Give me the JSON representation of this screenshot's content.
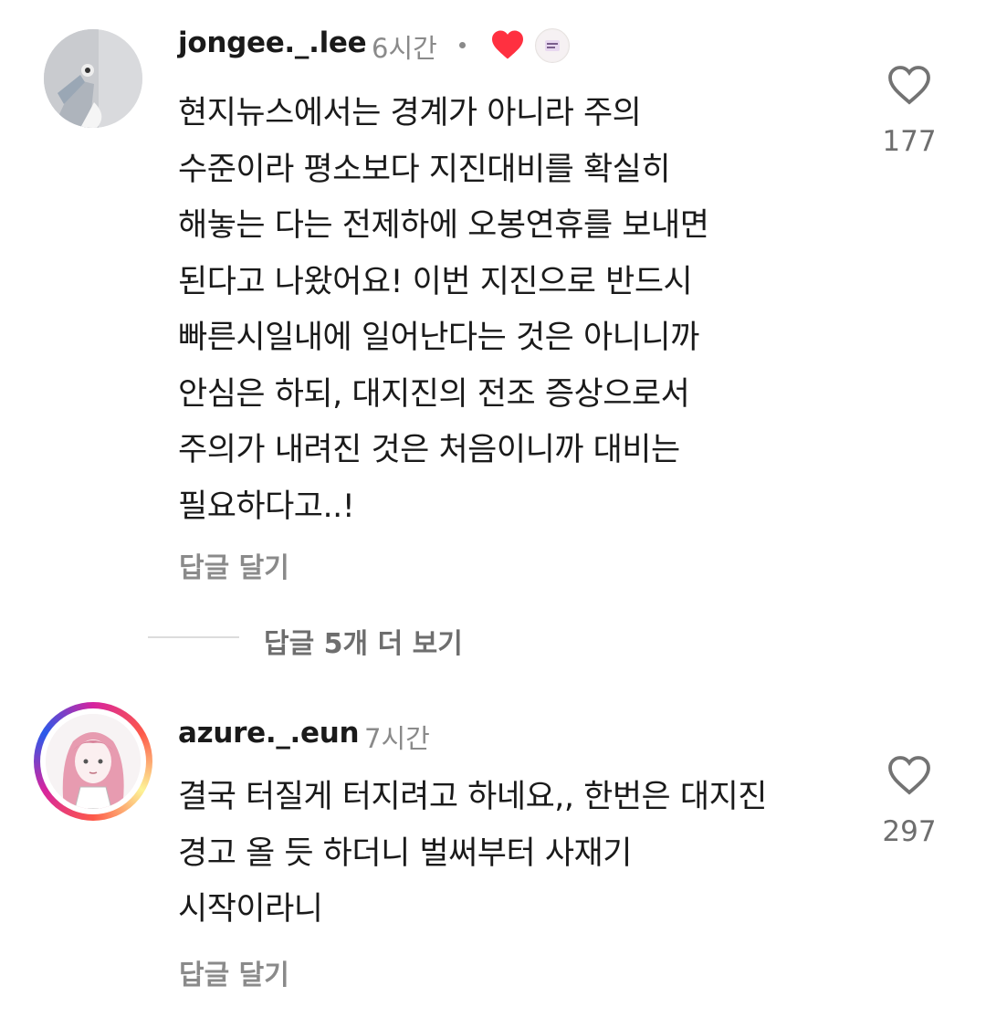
{
  "comments": [
    {
      "username": "jongee._.lee",
      "time": "6시간",
      "text": "현지뉴스에서는 경계가 아니라 주의\n수준이라 평소보다 지진대비를 확실히\n해놓는 다는 전제하에 오봉연휴를 보내면\n된다고 나왔어요! 이번 지진으로 반드시\n빠른시일내에 일어난다는 것은 아니니까\n안심은 하되, 대지진의 전조 증상으로서\n주의가 내려진 것은 처음이니까 대비는\n필요하다고..!",
      "reply_label": "답글 달기",
      "like_count": "177",
      "creator_liked": true,
      "more_replies": "답글 5개 더 보기",
      "avatar_icon": "profile-photo",
      "creator_avatar_icon": "creator-profile-photo"
    },
    {
      "username": "azure._.eun",
      "time": "7시간",
      "text": "결국 터질게 터지려고 하네요,, 한번은 대지진\n경고 올 듯 하더니 벌써부터 사재기\n시작이라니",
      "reply_label": "답글 달기",
      "like_count": "297",
      "avatar_icon": "illustrated-character-avatar",
      "story_ring": true
    }
  ],
  "colors": {
    "heart_red": "#ff3040",
    "muted_text": "#8a8a8a",
    "like_outline": "#737373"
  }
}
